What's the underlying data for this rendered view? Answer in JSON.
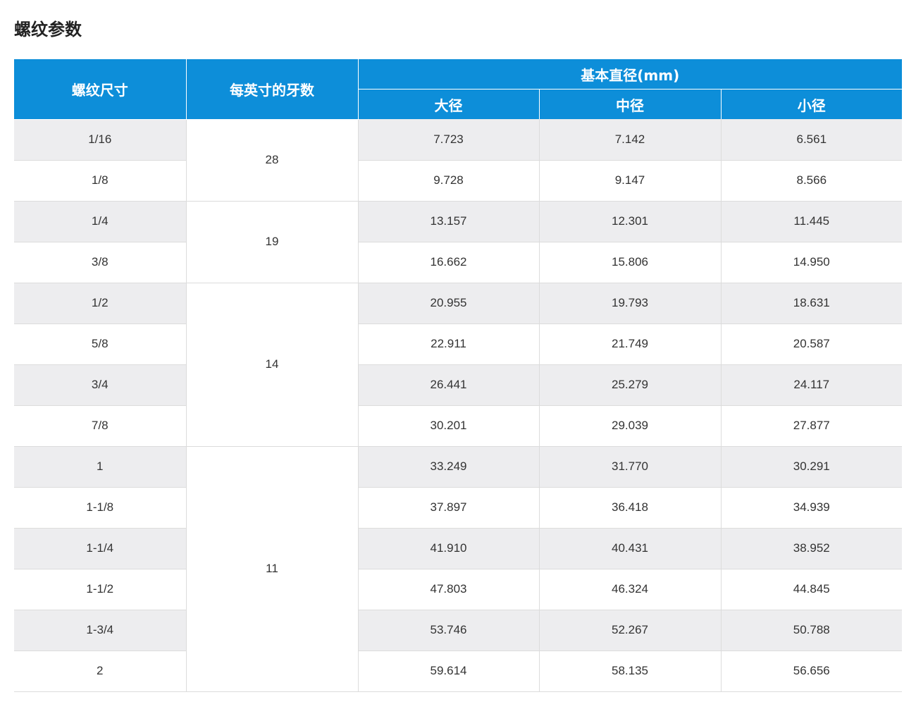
{
  "page_title": "螺纹参数",
  "table": {
    "headers": {
      "thread_size": "螺纹尺寸",
      "tpi": "每英寸的牙数",
      "basic_diameter": "基本直径(mm)",
      "major": "大径",
      "pitch": "中径",
      "minor": "小径"
    },
    "rows": [
      {
        "size": "1/16",
        "tpi": "28",
        "major": "7.723",
        "pitch": "7.142",
        "minor": "6.561"
      },
      {
        "size": "1/8",
        "major": "9.728",
        "pitch": "9.147",
        "minor": "8.566"
      },
      {
        "size": "1/4",
        "tpi": "19",
        "major": "13.157",
        "pitch": "12.301",
        "minor": "11.445"
      },
      {
        "size": "3/8",
        "major": "16.662",
        "pitch": "15.806",
        "minor": "14.950"
      },
      {
        "size": "1/2",
        "tpi": "14",
        "major": "20.955",
        "pitch": "19.793",
        "minor": "18.631"
      },
      {
        "size": "5/8",
        "major": "22.911",
        "pitch": "21.749",
        "minor": "20.587"
      },
      {
        "size": "3/4",
        "major": "26.441",
        "pitch": "25.279",
        "minor": "24.117"
      },
      {
        "size": "7/8",
        "major": "30.201",
        "pitch": "29.039",
        "minor": "27.877"
      },
      {
        "size": "1",
        "tpi": "11",
        "major": "33.249",
        "pitch": "31.770",
        "minor": "30.291"
      },
      {
        "size": "1-1/8",
        "major": "37.897",
        "pitch": "36.418",
        "minor": "34.939"
      },
      {
        "size": "1-1/4",
        "major": "41.910",
        "pitch": "40.431",
        "minor": "38.952"
      },
      {
        "size": "1-1/2",
        "major": "47.803",
        "pitch": "46.324",
        "minor": "44.845"
      },
      {
        "size": "1-3/4",
        "major": "53.746",
        "pitch": "52.267",
        "minor": "50.788"
      },
      {
        "size": "2",
        "major": "59.614",
        "pitch": "58.135",
        "minor": "56.656"
      }
    ]
  },
  "colors": {
    "header_bg": "#0d8ed9",
    "header_text": "#ffffff",
    "stripe_bg": "#ededef",
    "border": "#dcdcdc"
  }
}
